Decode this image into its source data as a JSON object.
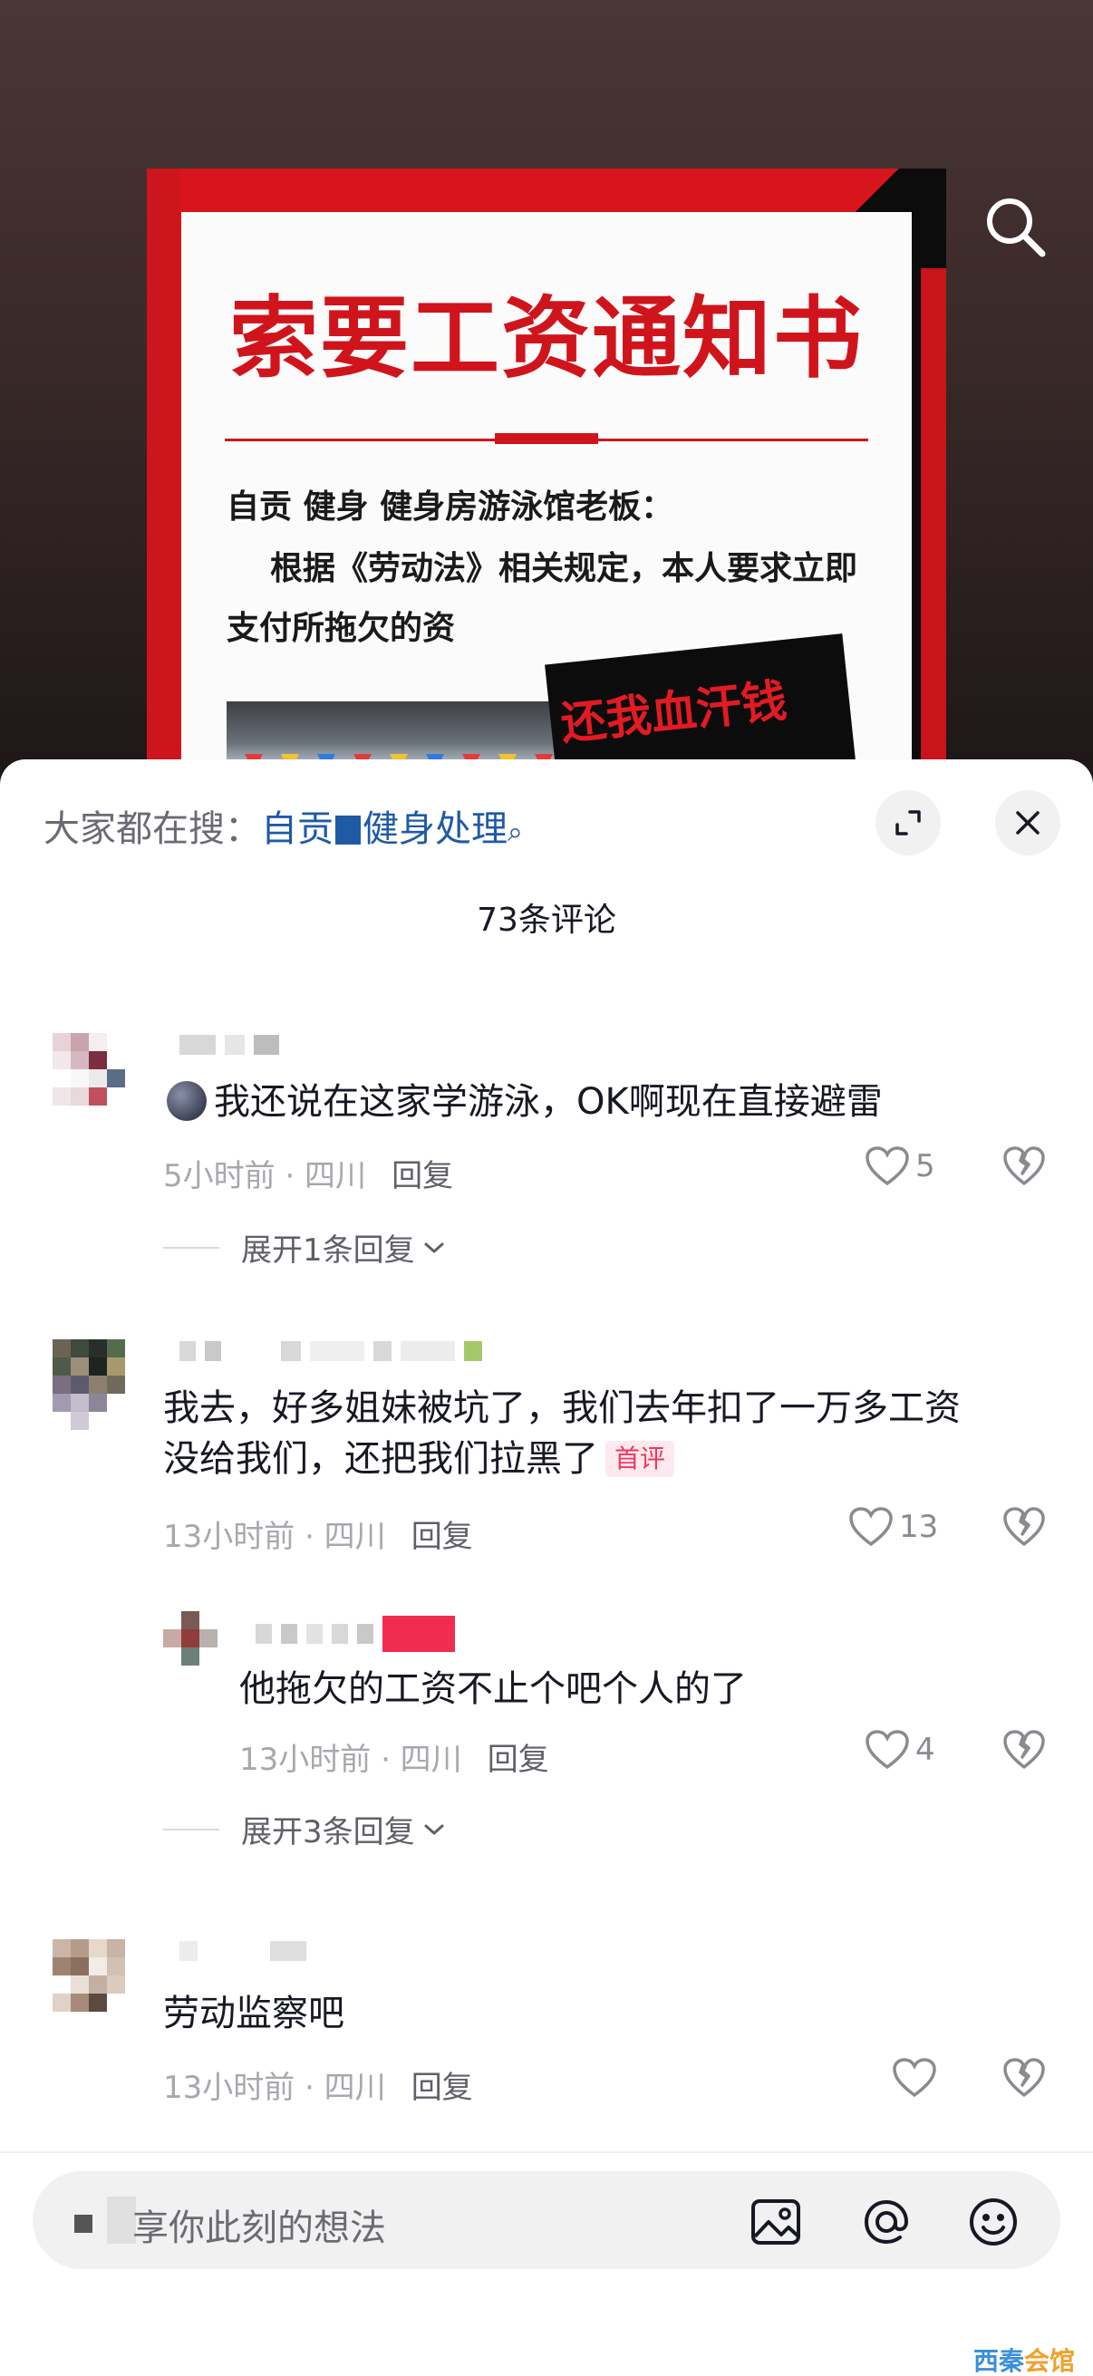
{
  "video": {
    "poster_title": "索要工资通知书",
    "poster_line1": "自贡 健身 健身房游泳馆老板：",
    "poster_line2": "根据《劳动法》相关规定，本人要求立即",
    "poster_line3": "支付所拖欠的资",
    "poster_sign": "还我血汗钱",
    "search_icon": "search-icon"
  },
  "sheet": {
    "hot_search_prefix": "大家都在搜：",
    "hot_search_part1": "自贡",
    "hot_search_part2": "健身处理",
    "hot_search_icon": "⌕",
    "comment_count": "73条评论",
    "expand_icon": "expand-icon",
    "close_icon": "close-icon"
  },
  "comments": [
    {
      "text": "我还说在这家学游泳，OK啊现在直接避雷",
      "time_location": "5小时前 · 四川",
      "reply_label": "回复",
      "likes": "5",
      "expand_label": "展开1条回复"
    },
    {
      "text_line1": "我去，好多姐妹被坑了，我们去年扣了一万多工资",
      "text_line2": "没给我们，还把我们拉黑了",
      "badge": "首评",
      "time_location": "13小时前 · 四川",
      "reply_label": "回复",
      "likes": "13"
    },
    {
      "text": "他拖欠的工资不止个吧个人的了",
      "time_location": "13小时前 · 四川",
      "reply_label": "回复",
      "likes": "4",
      "expand_label": "展开3条回复"
    },
    {
      "text": "劳动监察吧",
      "time_location": "13小时前 · 四川",
      "reply_label": "回复",
      "likes": ""
    }
  ],
  "input": {
    "placeholder": "享你此刻的想法",
    "image_icon": "image-icon",
    "at_icon": "at-icon",
    "emoji_icon": "emoji-icon"
  },
  "watermark": {
    "part1": "西秦",
    "part2": "会馆"
  },
  "colors": {
    "link": "#1f5aa5",
    "badge": "#f0365f",
    "poster_red": "#d0141c"
  }
}
